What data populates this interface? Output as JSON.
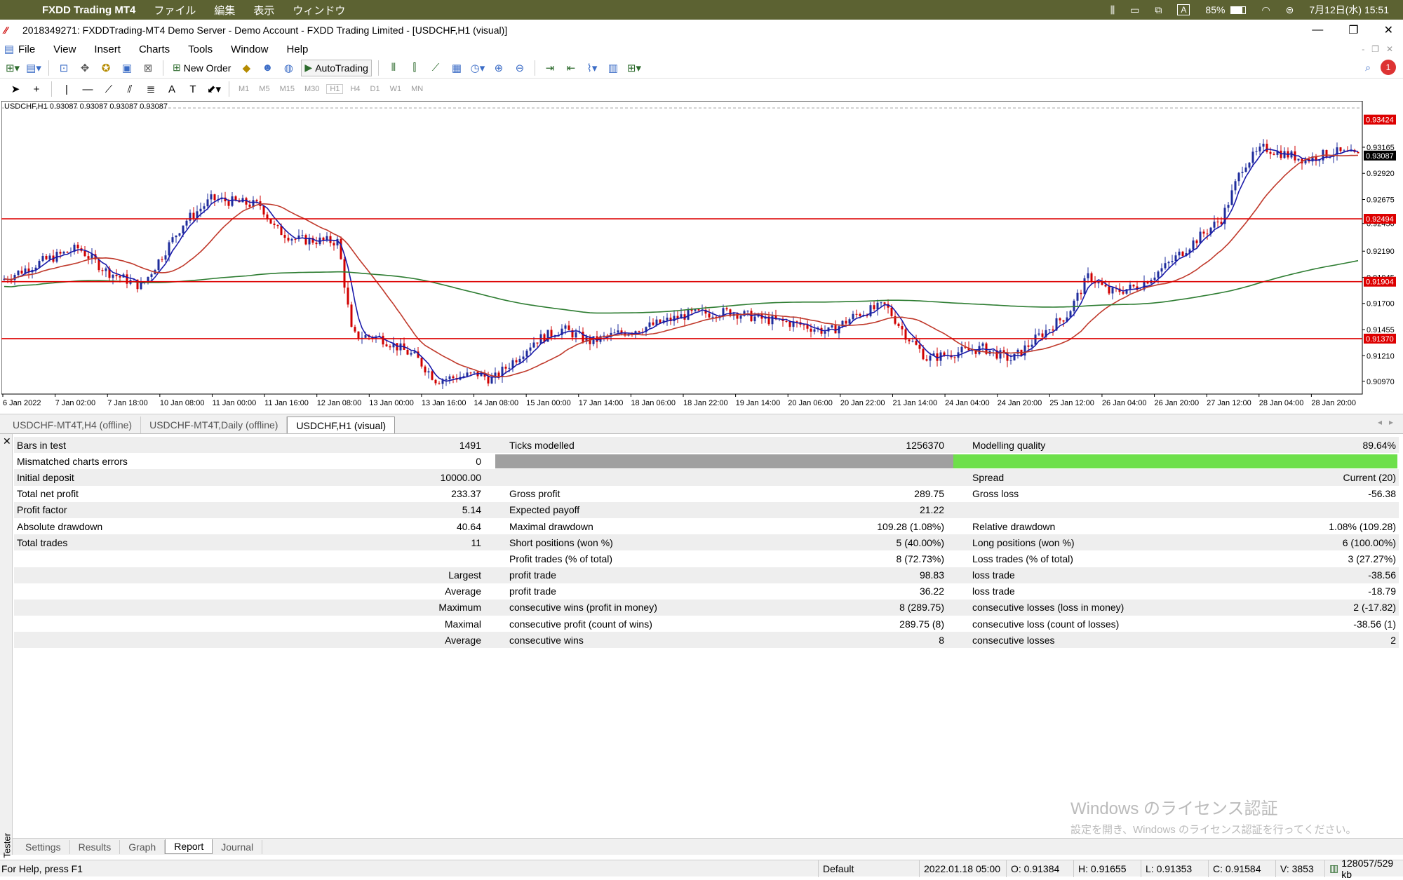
{
  "macbar": {
    "app": "FXDD Trading MT4",
    "menus": [
      "ファイル",
      "編集",
      "表示",
      "ウィンドウ"
    ],
    "battery": "85%",
    "datetime": "7月12日(水) 15:51",
    "input": "A"
  },
  "window": {
    "title": "2018349271: FXDDTrading-MT4 Demo Server - Demo Account - FXDD Trading Limited - [USDCHF,H1 (visual)]"
  },
  "menu": [
    "File",
    "View",
    "Insert",
    "Charts",
    "Tools",
    "Window",
    "Help"
  ],
  "toolbar": {
    "new_order": "New Order",
    "autotrading": "AutoTrading",
    "timeframes": [
      "M1",
      "M5",
      "M15",
      "M30",
      "H1",
      "H4",
      "D1",
      "W1",
      "MN"
    ],
    "notify_count": "1"
  },
  "chart": {
    "info": "USDCHF,H1  0.93087 0.93087 0.93087 0.93087",
    "price_labels": [
      "0.93165",
      "0.92920",
      "0.92675",
      "0.92450",
      "0.92190",
      "0.91945",
      "0.91700",
      "0.91455",
      "0.91210",
      "0.90970"
    ],
    "hlines": [
      {
        "label": "0.92494",
        "color": "#dd0000"
      },
      {
        "label": "0.91904",
        "color": "#dd0000"
      },
      {
        "label": "0.91370",
        "color": "#dd0000"
      }
    ],
    "top_label": "0.93424",
    "current_label": "0.93087",
    "time_labels": [
      "6 Jan 2022",
      "7 Jan 02:00",
      "7 Jan 18:00",
      "10 Jan 08:00",
      "11 Jan 00:00",
      "11 Jan 16:00",
      "12 Jan 08:00",
      "13 Jan 00:00",
      "13 Jan 16:00",
      "14 Jan 08:00",
      "15 Jan 00:00",
      "17 Jan 14:00",
      "18 Jan 06:00",
      "18 Jan 22:00",
      "19 Jan 14:00",
      "20 Jan 06:00",
      "20 Jan 22:00",
      "21 Jan 14:00",
      "24 Jan 04:00",
      "24 Jan 20:00",
      "25 Jan 12:00",
      "26 Jan 04:00",
      "26 Jan 20:00",
      "27 Jan 12:00",
      "28 Jan 04:00",
      "28 Jan 20:00"
    ],
    "ymin": 0.9085,
    "ymax": 0.9352
  },
  "chart_tabs": [
    "USDCHF-MT4T,H4 (offline)",
    "USDCHF-MT4T,Daily (offline)",
    "USDCHF,H1 (visual)"
  ],
  "report": [
    [
      "Bars in test",
      "1491",
      "Ticks modelled",
      "1256370",
      "Modelling quality",
      "89.64%"
    ],
    [
      "Mismatched charts errors",
      "0",
      "__BAR__",
      "",
      "",
      ""
    ],
    [
      "Initial deposit",
      "10000.00",
      "",
      "",
      "Spread",
      "Current (20)"
    ],
    [
      "Total net profit",
      "233.37",
      "Gross profit",
      "289.75",
      "Gross loss",
      "-56.38"
    ],
    [
      "Profit factor",
      "5.14",
      "Expected payoff",
      "21.22",
      "",
      ""
    ],
    [
      "Absolute drawdown",
      "40.64",
      "Maximal drawdown",
      "109.28 (1.08%)",
      "Relative drawdown",
      "1.08% (109.28)"
    ],
    [
      "Total trades",
      "11",
      "Short positions (won %)",
      "5 (40.00%)",
      "Long positions (won %)",
      "6 (100.00%)"
    ],
    [
      "",
      "",
      "Profit trades (% of total)",
      "8 (72.73%)",
      "Loss trades (% of total)",
      "3 (27.27%)"
    ],
    [
      "",
      "Largest",
      "profit trade",
      "98.83",
      "loss trade",
      "-38.56"
    ],
    [
      "",
      "Average",
      "profit trade",
      "36.22",
      "loss trade",
      "-18.79"
    ],
    [
      "",
      "Maximum",
      "consecutive wins (profit in money)",
      "8 (289.75)",
      "consecutive losses (loss in money)",
      "2 (-17.82)"
    ],
    [
      "",
      "Maximal",
      "consecutive profit (count of wins)",
      "289.75 (8)",
      "consecutive loss (count of losses)",
      "-38.56 (1)"
    ],
    [
      "",
      "Average",
      "consecutive wins",
      "8",
      "consecutive losses",
      "2"
    ]
  ],
  "modelling_quality_fraction": 0.8964,
  "tester_label": "Tester",
  "bottom_tabs": [
    "Settings",
    "Results",
    "Graph",
    "Report",
    "Journal"
  ],
  "watermark": {
    "line1": "Windows のライセンス認証",
    "line2": "設定を開き、Windows のライセンス認証を行ってください。"
  },
  "status": {
    "help": "For Help, press F1",
    "profile": "Default",
    "time": "2022.01.18 05:00",
    "open": "O: 0.91384",
    "high": "H: 0.91655",
    "low": "L: 0.91353",
    "close": "C: 0.91584",
    "volume": "V: 3853",
    "net": "128057/529 kb"
  }
}
